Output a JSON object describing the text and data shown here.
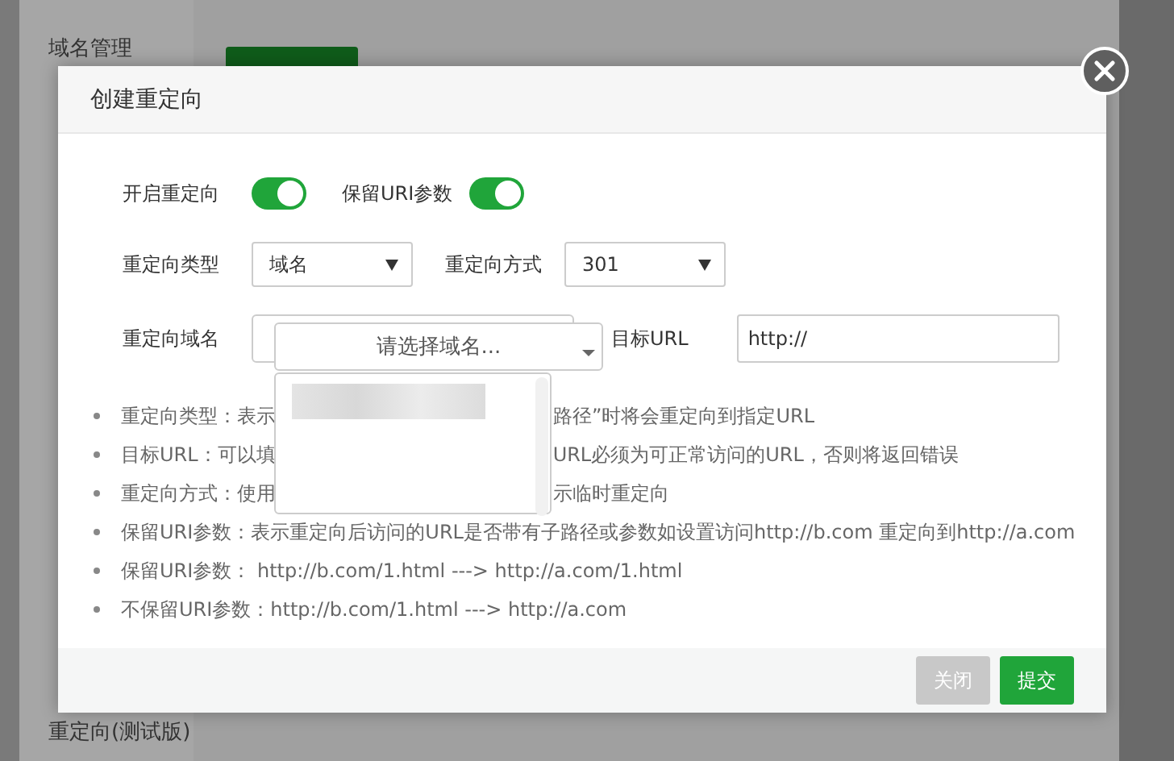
{
  "background": {
    "sidebar_items": [
      "域名管理",
      "重定向(测试版)"
    ]
  },
  "dialog": {
    "title": "创建重定向",
    "toggles": [
      {
        "label": "开启重定向",
        "on": true
      },
      {
        "label": "保留URI参数",
        "on": true
      }
    ],
    "selects": [
      {
        "label": "重定向类型",
        "value": "域名"
      },
      {
        "label": "重定向方式",
        "value": "301"
      }
    ],
    "domain": {
      "label": "重定向域名",
      "placeholder": "请选择域名..."
    },
    "target": {
      "label": "目标URL",
      "value": "http://"
    },
    "notes": [
      {
        "kind": "covered",
        "before": "重定向类型：表示",
        "after": "路径”时将会重定向到指定URL"
      },
      {
        "kind": "covered",
        "before": "目标URL：可以填",
        "after": "URL必须为可正常访问的URL，否则将返回错误"
      },
      {
        "kind": "covered",
        "before": "重定向方式：使用",
        "after": "示临时重定向"
      },
      {
        "kind": "full",
        "text": "保留URI参数：表示重定向后访问的URL是否带有子路径或参数如设置访问http://b.com 重定向到http://a.com"
      },
      {
        "kind": "full",
        "text": "保留URI参数： http://b.com/1.html ---> http://a.com/1.html"
      },
      {
        "kind": "full",
        "text": "不保留URI参数：http://b.com/1.html ---> http://a.com"
      }
    ],
    "buttons": [
      {
        "label": "关闭",
        "kind": "secondary"
      },
      {
        "label": "提交",
        "kind": "primary"
      }
    ]
  }
}
